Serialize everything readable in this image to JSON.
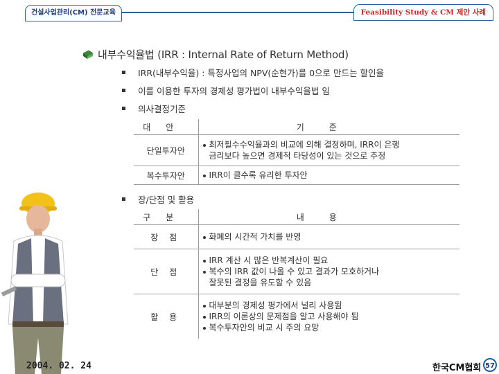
{
  "header": {
    "left_tab": "건설사업관리(CM) 전문교육",
    "right_tab": "Feasibility Study & CM 제안 사례"
  },
  "heading": "내부수익율법 (IRR : Internal Rate of Return Method)",
  "bullets": [
    "IRR(내부수익율) : 특정사업의 NPV(순현가)를 0으로 만드는 할인율",
    "이를 이용한 투자의 경제성 평가법이 내부수익율법 임",
    "의사결정기준",
    "장/단점 및 활용"
  ],
  "decision_table": {
    "headers": [
      "대안",
      "기준"
    ],
    "rows": [
      {
        "category": "단일투자안",
        "lines": [
          "최저필수수익율과의 비교에 의해 결정하며, IRR이 은행",
          "금리보다 높으면 경제적 타당성이 있는 것으로 추정"
        ]
      },
      {
        "category": "복수투자안",
        "lines": [
          "IRR이 클수록 유리한 투자안"
        ]
      }
    ]
  },
  "pros_cons_table": {
    "headers": [
      "구분",
      "내용"
    ],
    "rows": [
      {
        "category": "장 점",
        "items": [
          [
            "화폐의 시간적 가치를 반영"
          ]
        ]
      },
      {
        "category": "단 점",
        "items": [
          [
            "IRR 계산 시 많은 반복계산이 필요"
          ],
          [
            "복수의 IRR 값이 나올 수 있고 결과가 모호하거나",
            "잘못된 결정을 유도할 수 있음"
          ]
        ]
      },
      {
        "category": "활 용",
        "items": [
          [
            "대부분의 경제성 평가에서 널리 사용됨"
          ],
          [
            "IRR의 이론상의 문제점을 알고 사용해야 됨"
          ],
          [
            "복수투자안의 비교 시 주의 요망"
          ]
        ]
      }
    ]
  },
  "footer": {
    "date": "2004. 02. 24",
    "org": "한국CM협회",
    "page": "57"
  },
  "icons": [
    "book-icon",
    "construction-worker-illustration"
  ],
  "colors": {
    "accent_blue": "#2f5fa0",
    "title_red": "#cc2a2a"
  }
}
